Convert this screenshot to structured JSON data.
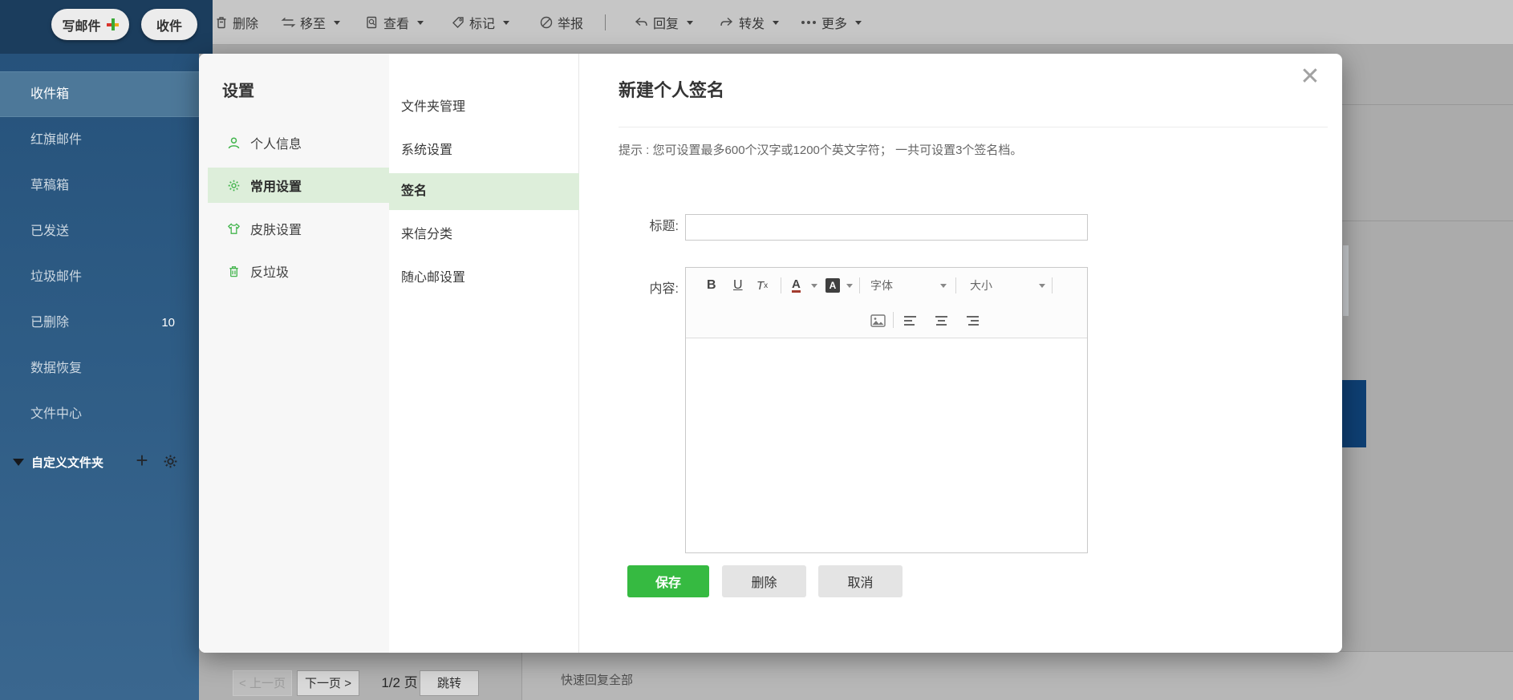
{
  "header": {
    "write_button": "写邮件",
    "receive_button": "收件"
  },
  "toolbar": {
    "delete": "删除",
    "move": "移至",
    "view": "查看",
    "mark": "标记",
    "report": "举报",
    "reply": "回复",
    "forward": "转发",
    "more": "更多"
  },
  "sidebar": {
    "folders": [
      {
        "label": "收件箱",
        "selected": true
      },
      {
        "label": "红旗邮件"
      },
      {
        "label": "草稿箱"
      },
      {
        "label": "已发送"
      },
      {
        "label": "垃圾邮件"
      },
      {
        "label": "已删除",
        "count": "10"
      },
      {
        "label": "数据恢复"
      },
      {
        "label": "文件中心"
      }
    ],
    "custom_folders_label": "自定义文件夹"
  },
  "settings": {
    "title": "设置",
    "nav": [
      {
        "label": "个人信息",
        "icon": "user-icon"
      },
      {
        "label": "常用设置",
        "icon": "gear-icon",
        "selected": true
      },
      {
        "label": "皮肤设置",
        "icon": "shirt-icon"
      },
      {
        "label": "反垃圾",
        "icon": "trash-icon"
      }
    ],
    "subnav": [
      {
        "label": "文件夹管理"
      },
      {
        "label": "系统设置"
      },
      {
        "label": "签名",
        "selected": true
      },
      {
        "label": "来信分类"
      },
      {
        "label": "随心邮设置"
      }
    ]
  },
  "signature_form": {
    "title": "新建个人签名",
    "tip": "提示 : 您可设置最多600个汉字或1200个英文字符； 一共可设置3个签名档。",
    "title_label": "标题:",
    "title_value": "",
    "content_label": "内容:",
    "editor": {
      "bold": "B",
      "underline": "U",
      "clear_t": "T",
      "clear_x": "x",
      "text_color": "A",
      "bg_color": "A",
      "font_select": "字体",
      "size_select": "大小"
    },
    "save": "保存",
    "delete": "删除",
    "cancel": "取消"
  },
  "pagination": {
    "prev": "< 上一页",
    "next": "下一页 >",
    "page_info": "1/2 页",
    "jump": "跳转"
  },
  "quick_reply_label": "快速回复全部",
  "icons": {
    "toolbar": [
      "trash-icon",
      "move-icon",
      "view-icon",
      "tag-icon",
      "block-icon",
      "reply-icon",
      "forward-icon",
      "more-dots-icon"
    ],
    "editor": [
      "image-icon",
      "align-left-icon",
      "align-center-icon",
      "align-right-icon"
    ]
  },
  "colors": {
    "accent_green": "#36ba41",
    "nav_highlight_green": "#ddeeda",
    "sidebar_blue": "#2e5c85",
    "header_navy": "#1b3d5d",
    "overlay_gray": "#ababab"
  }
}
